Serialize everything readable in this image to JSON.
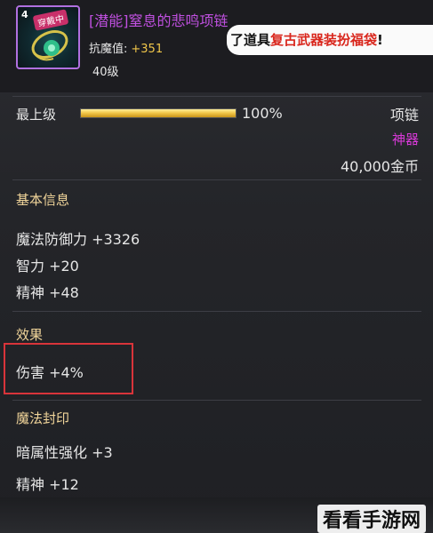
{
  "item": {
    "level_badge": "4",
    "title": "[潜能]窒息的悲鸣项链",
    "stat_label": "抗魔值:",
    "stat_value": "+351",
    "level": "40级"
  },
  "notice": {
    "prefix": "了道具",
    "highlight": "复古武器装扮福袋",
    "suffix": "!"
  },
  "upgrade": {
    "label": "最上级",
    "percent_text": "100%",
    "progress": 1.0
  },
  "item_type": "项链",
  "rarity": "神器",
  "price": "40,000金币",
  "sections": {
    "basic": {
      "title": "基本信息",
      "lines": [
        "魔法防御力 +3326",
        "智力 +20",
        "精神 +48"
      ]
    },
    "effect": {
      "title": "效果",
      "lines": [
        "伤害 +4%"
      ]
    },
    "seal": {
      "title": "魔法封印",
      "lines": [
        "暗属性强化 +3",
        "精神 +12"
      ]
    }
  },
  "watermark": "看看手游网",
  "colors": {
    "title_purple": "#c050e0",
    "rarity_magenta": "#d93ad9",
    "section_gold": "#f1d59a",
    "highlight_red": "#d9343a",
    "bar_gold": "#f2c84b"
  }
}
